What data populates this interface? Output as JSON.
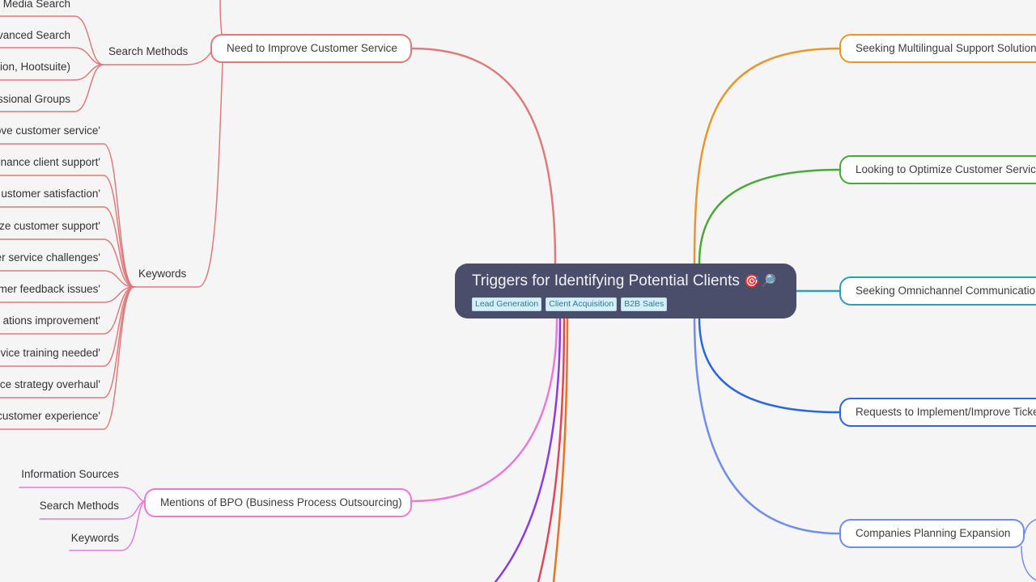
{
  "root": {
    "title": "Triggers for Identifying Potential Clients",
    "icons": [
      "target-emoji",
      "magnifier-emoji"
    ],
    "icon_glyphs": [
      "🎯",
      "🔎"
    ],
    "tags": [
      "Lead Generation",
      "Client Acquisition",
      "B2B Sales"
    ],
    "colors": {
      "background": "#4b4e6a",
      "tag_bg": "#d6eef6",
      "tag_text": "#2f7a99"
    }
  },
  "left_branches": [
    {
      "label": "Need to Improve Customer Service",
      "color": "#e07a7a",
      "children": [
        {
          "label": "Search Methods",
          "children": [
            "l Media Search",
            "vanced Search",
            "ion, Hootsuite)",
            "ssional Groups"
          ]
        },
        {
          "label": "Keywords",
          "children": [
            "ove customer service'",
            "nance client support'",
            "ustomer satisfaction'",
            "ze customer support'",
            "er service challenges'",
            "mer feedback issues'",
            "ations improvement'",
            "vice training needed'",
            "ce strategy overhaul'",
            "customer experience'"
          ]
        }
      ]
    },
    {
      "label": "Mentions of BPO (Business Process Outsourcing)",
      "color": "#e87bd6",
      "children": [
        "Information Sources",
        "Search Methods",
        "Keywords"
      ]
    }
  ],
  "right_branches": [
    {
      "label": "Seeking Multilingual Support Solution",
      "color": "#e8962c"
    },
    {
      "label": "Looking to Optimize Customer Service",
      "color": "#4aa83a"
    },
    {
      "label": "Seeking Omnichannel Communication",
      "color": "#2b9fb8"
    },
    {
      "label": "Requests to Implement/Improve Ticke",
      "color": "#2a66e0"
    },
    {
      "label": "Companies Planning Expansion",
      "color": "#6f8cf0"
    }
  ],
  "offscreen_branch_colors": [
    "#8a3be8",
    "#e0465a",
    "#f0701e"
  ]
}
